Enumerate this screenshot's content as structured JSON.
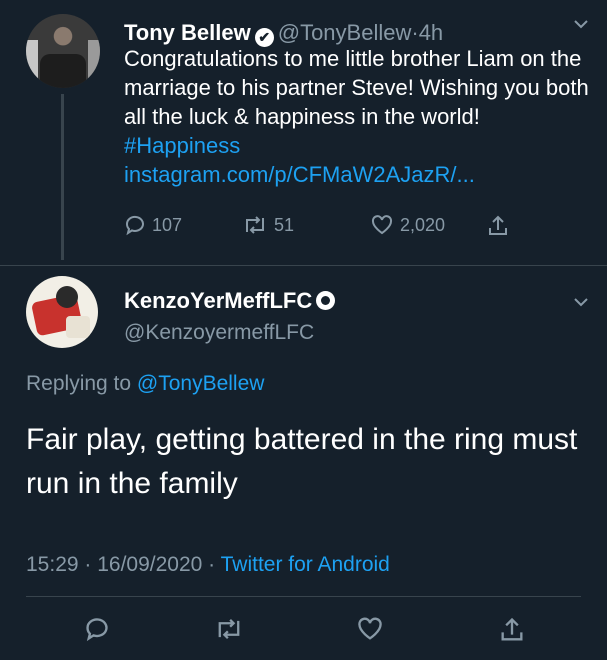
{
  "tweet": {
    "author_name": "Tony Bellew",
    "verified_glyph": "✔",
    "handle": "@TonyBellew",
    "dot": "·",
    "time": "4h",
    "menu_icon": "chevron-down-icon",
    "text": "Congratulations to me little brother Liam on the marriage to his partner Steve! Wishing you both all the luck & happiness in the world! ",
    "hashtag": "#Happiness",
    "link": "instagram.com/p/CFMaW2AJazR/...",
    "replies": "107",
    "retweets": "51",
    "likes": "2,020"
  },
  "reply": {
    "author_name": "KenzoYerMeffLFC",
    "handle": "@KenzoyermeffLFC",
    "replying_prefix": "Replying to ",
    "replying_to": "@TonyBellew",
    "text": "Fair play, getting battered in the ring must run in the family",
    "timestamp": "15:29 · 16/09/2020 · ",
    "source": "Twitter for Android"
  },
  "colors": {
    "background": "#15202b",
    "accent": "#1da1f2",
    "muted": "#8899a6"
  }
}
